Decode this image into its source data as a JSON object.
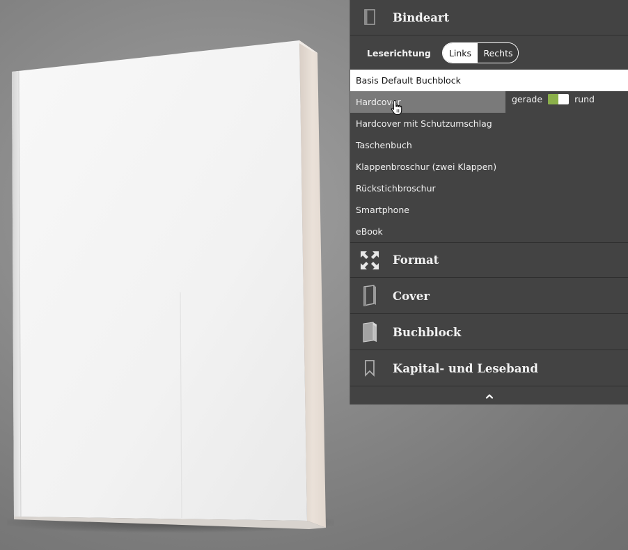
{
  "sections": {
    "binding": {
      "label": "Bindeart",
      "icon": "book-closed-icon"
    },
    "format": {
      "label": "Format",
      "icon": "expand-arrows-icon"
    },
    "cover": {
      "label": "Cover",
      "icon": "book-cover-icon"
    },
    "bookblock": {
      "label": "Buchblock",
      "icon": "book-block-icon"
    },
    "ribbon": {
      "label": "Kapital- und Leseband",
      "icon": "bookmark-icon"
    }
  },
  "reading_direction": {
    "label": "Leserichtung",
    "options": [
      "Links",
      "Rechts"
    ],
    "selected": "Links"
  },
  "binding_types": {
    "items": [
      "Basis Default Buchblock",
      "Hardcover",
      "Hardcover mit Schutzumschlag",
      "Taschenbuch",
      "Klappenbroschur (zwei Klappen)",
      "Rückstichbroschur",
      "Smartphone",
      "eBook"
    ],
    "selected": "Basis Default Buchblock",
    "hovered": "Hardcover"
  },
  "spine": {
    "left_label": "gerade",
    "right_label": "rund",
    "level": 0.5,
    "accent": "#8bb04a"
  },
  "collapse_icon": "chevron-up-icon",
  "colors": {
    "panel_bg": "#434343",
    "book_cover": "#f3f3f3",
    "book_pages": "#e6dcd4"
  }
}
